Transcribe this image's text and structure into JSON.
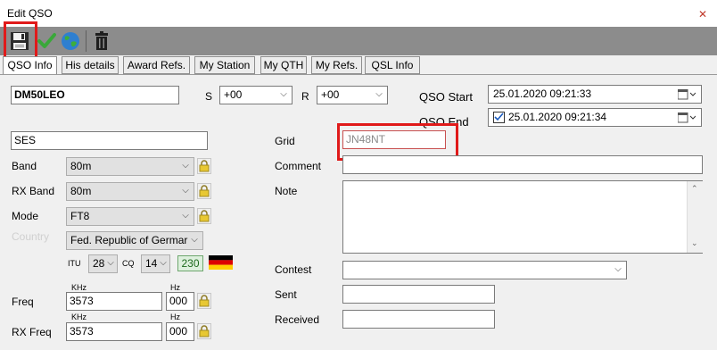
{
  "window": {
    "title": "Edit QSO"
  },
  "toolbar": {
    "save_icon": "floppy-disk-icon",
    "confirm_icon": "green-check-icon",
    "web_icon": "globe-icon",
    "delete_icon": "trash-icon"
  },
  "tabs": [
    {
      "label": "QSO Info",
      "active": true
    },
    {
      "label": "His details"
    },
    {
      "label": "Award Refs."
    },
    {
      "label": "My Station"
    },
    {
      "label": "My QTH"
    },
    {
      "label": "My Refs."
    },
    {
      "label": "QSL Info"
    }
  ],
  "qso": {
    "callsign": "DM50LEO",
    "s_label": "S",
    "s_value": "+00",
    "r_label": "R",
    "r_value": "+00",
    "start_label": "QSO Start",
    "start_value": "25.01.2020 09:21:33",
    "end_label": "QSO End",
    "end_value": "25.01.2020 09:21:34",
    "end_checked": true,
    "name_value": "SES",
    "grid_label": "Grid",
    "grid_value": "JN48NT",
    "band_label": "Band",
    "band_value": "80m",
    "comment_label": "Comment",
    "comment_value": "",
    "rxband_label": "RX Band",
    "rxband_value": "80m",
    "note_label": "Note",
    "note_value": "",
    "mode_label": "Mode",
    "mode_value": "FT8",
    "country_label": "Country",
    "country_value": "Fed. Republic of Germar",
    "itu_label": "ITU",
    "itu_value": "28",
    "cq_label": "CQ",
    "cq_value": "14",
    "dxcc_badge": "230",
    "contest_label": "Contest",
    "contest_value": "",
    "freq_label": "Freq",
    "freq_unit": "KHz",
    "freq_value": "3573",
    "freq_hz_unit": "Hz",
    "freq_hz_value": "000",
    "sent_label": "Sent",
    "sent_value": "",
    "received_label": "Received",
    "received_value": "",
    "rxfreq_label": "RX Freq",
    "rxfreq_unit": "KHz",
    "rxfreq_value": "3573",
    "rxfreq_hz_unit": "Hz",
    "rxfreq_hz_value": "000"
  },
  "colors": {
    "highlight": "#e01a1a",
    "toolbar_bg": "#8c8c8c",
    "badge_green": "#1d6a1d"
  },
  "country_flag": "germany-flag-icon"
}
